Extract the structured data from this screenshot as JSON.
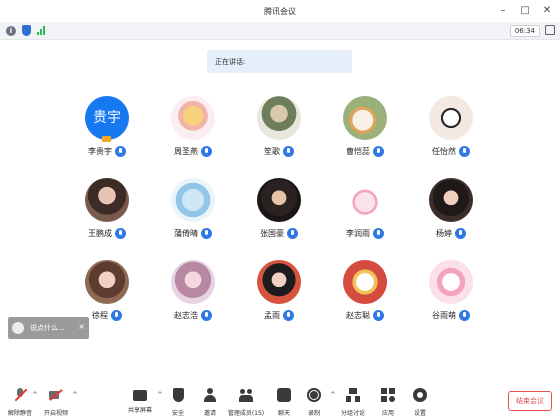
{
  "window": {
    "title": "腾讯会议"
  },
  "status": {
    "timer": "06:34"
  },
  "speaking": {
    "label": "正在讲话:"
  },
  "participants": [
    {
      "name": "李贵宇",
      "avatar_text": "贵宇",
      "host": true
    },
    {
      "name": "周圣燕",
      "avatar_text": ""
    },
    {
      "name": "笙歌",
      "avatar_text": ""
    },
    {
      "name": "曹恺蕊",
      "avatar_text": ""
    },
    {
      "name": "任怡然",
      "avatar_text": ""
    },
    {
      "name": "王鹏成",
      "avatar_text": ""
    },
    {
      "name": "蒲倚晴",
      "avatar_text": ""
    },
    {
      "name": "张国豪",
      "avatar_text": ""
    },
    {
      "name": "李润雨",
      "avatar_text": ""
    },
    {
      "name": "杨婷",
      "avatar_text": ""
    },
    {
      "name": "徐程",
      "avatar_text": ""
    },
    {
      "name": "赵志浩",
      "avatar_text": ""
    },
    {
      "name": "孟雨",
      "avatar_text": ""
    },
    {
      "name": "赵志聪",
      "avatar_text": ""
    },
    {
      "name": "谷雨萌",
      "avatar_text": ""
    }
  ],
  "chat": {
    "text": "说点什么...",
    "close": "×"
  },
  "toolbar": {
    "unmute": "解除静音",
    "start_video": "开启视频",
    "share_screen": "共享屏幕",
    "security": "安全",
    "invite": "邀请",
    "manage_members": "管理成员(15)",
    "chat": "聊天",
    "record": "录制",
    "breakout": "分组讨论",
    "apps": "应用",
    "settings": "设置",
    "end_meeting": "结束会议"
  },
  "colors": {
    "accent": "#2f79e6",
    "end": "#e15151",
    "avatar_blue": "#1679f0"
  }
}
